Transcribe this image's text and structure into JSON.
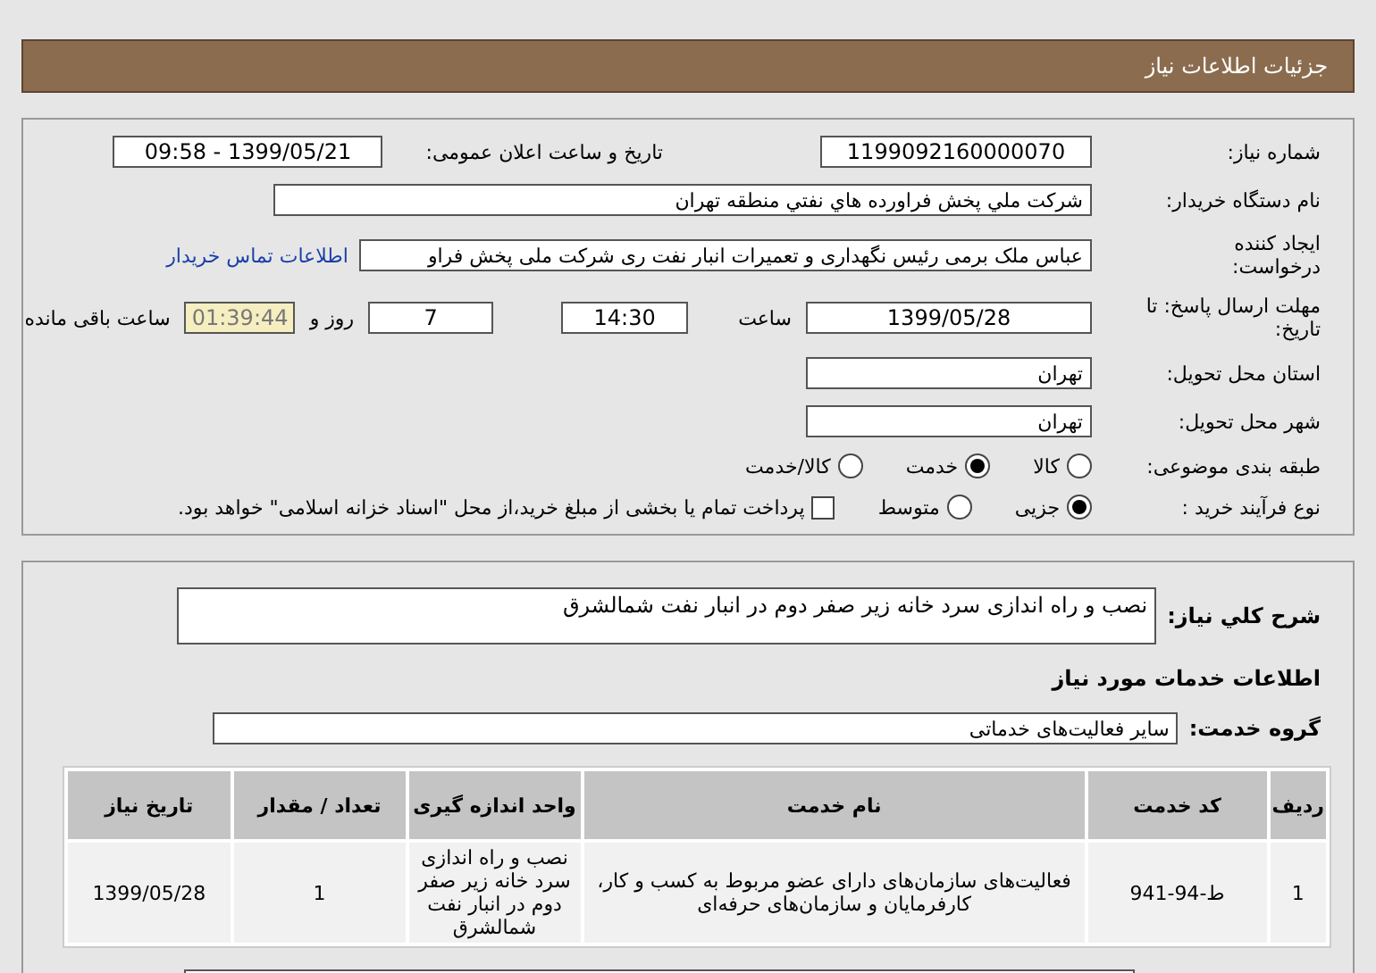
{
  "header": {
    "title": "جزئیات اطلاعات نیاز"
  },
  "info": {
    "need_number": {
      "label": "شماره نیاز:",
      "value": "1199092160000070"
    },
    "announce": {
      "label": "تاریخ و ساعت اعلان عمومی:",
      "value": "1399/05/21 - 09:58"
    },
    "buyer": {
      "label": "نام دستگاه خریدار:",
      "value": "شرکت ملي پخش فراورده هاي نفتي منطقه تهران"
    },
    "requester": {
      "label": "ایجاد کننده درخواست:",
      "value": "عباس ملک برمی رئیس نگهداری و تعمیرات انبار نفت ری شرکت ملی پخش فراو",
      "link": "اطلاعات تماس خریدار"
    },
    "deadline": {
      "label": "مهلت ارسال پاسخ: تا تاریخ:",
      "date": "1399/05/28",
      "time_label": "ساعت",
      "time": "14:30",
      "days": "7",
      "days_label": "روز و",
      "remaining": "01:39:44",
      "remaining_label": "ساعت باقی مانده"
    },
    "province": {
      "label": "استان محل تحویل:",
      "value": "تهران"
    },
    "city": {
      "label": "شهر محل تحویل:",
      "value": "تهران"
    },
    "category": {
      "label": "طبقه بندی موضوعی:",
      "options": [
        {
          "label": "کالا",
          "selected": false
        },
        {
          "label": "خدمت",
          "selected": true
        },
        {
          "label": "کالا/خدمت",
          "selected": false
        }
      ]
    },
    "purchase": {
      "label": "نوع فرآیند خرید :",
      "options": [
        {
          "label": "جزیی",
          "selected": true
        },
        {
          "label": "متوسط",
          "selected": false
        }
      ],
      "treasury": {
        "checked": false,
        "label": "پرداخت تمام یا بخشی از مبلغ خرید،از محل \"اسناد خزانه اسلامی\" خواهد بود."
      }
    }
  },
  "services": {
    "description": {
      "label": "شرح کلي نياز:",
      "value": "نصب و راه اندازی سرد خانه زیر صفر دوم در انبار نفت شمالشرق"
    },
    "section_title": "اطلاعات خدمات مورد نیاز",
    "group": {
      "label": "گروه خدمت:",
      "value": "سایر فعالیت‌های خدماتی"
    },
    "table": {
      "columns": [
        "ردیف",
        "کد خدمت",
        "نام خدمت",
        "واحد اندازه گیری",
        "تعداد / مقدار",
        "تاریخ نیاز"
      ],
      "rows": [
        [
          "1",
          "ط-94-941",
          "فعالیت‌های سازمان‌های دارای عضو مربوط به کسب و کار، کارفرمایان و سازمان‌های حرفه‌ای",
          "نصب و راه اندازی سرد خانه زیر صفر دوم در انبار نفت شمالشرق",
          "1",
          "1399/05/28"
        ]
      ]
    }
  }
}
